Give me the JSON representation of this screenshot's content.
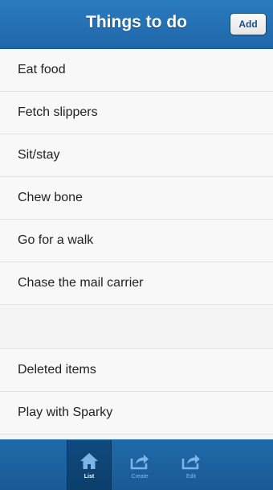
{
  "header": {
    "title": "Things to do",
    "add_label": "Add"
  },
  "list": {
    "items": [
      {
        "label": "Eat food"
      },
      {
        "label": "Fetch slippers"
      },
      {
        "label": "Sit/stay"
      },
      {
        "label": "Chew bone"
      },
      {
        "label": "Go for a walk"
      },
      {
        "label": "Chase the mail carrier"
      },
      {
        "label": ""
      },
      {
        "label": "Deleted items"
      },
      {
        "label": "Play with Sparky"
      }
    ]
  },
  "navbar": {
    "tabs": [
      {
        "label": "List",
        "icon": "home-icon",
        "active": true
      },
      {
        "label": "Create",
        "icon": "share-icon",
        "active": false
      },
      {
        "label": "Edit",
        "icon": "share-icon",
        "active": false
      }
    ]
  },
  "colors": {
    "header": "#1f67a8",
    "navbar": "#195a93",
    "active_tab": "#0f4a7e",
    "icon": "#7fb4e6"
  }
}
